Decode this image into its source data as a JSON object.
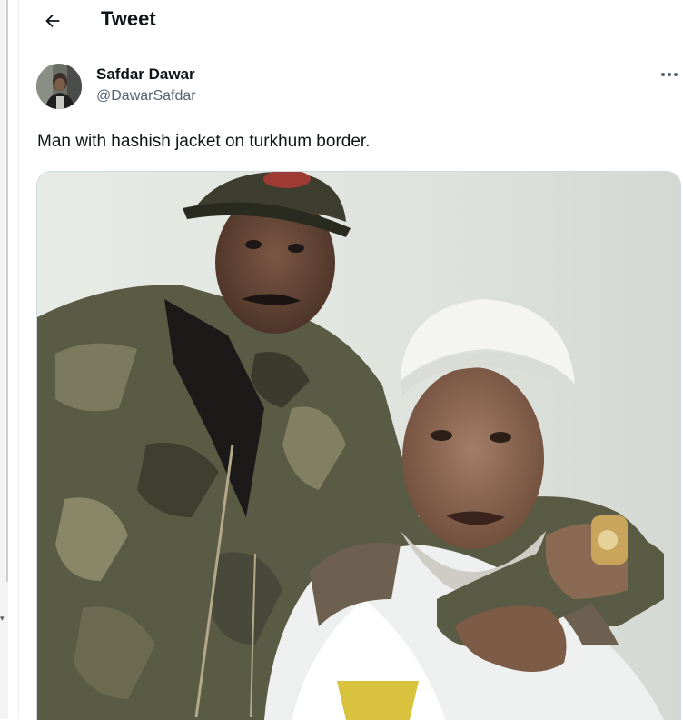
{
  "header": {
    "title": "Tweet",
    "back_icon": "arrow-left-icon"
  },
  "author": {
    "display_name": "Safdar Dawar",
    "handle": "@DawarSafdar",
    "avatar": "avatar-photo"
  },
  "tweet": {
    "text": "Man with hashish jacket on turkhum border.",
    "more_icon": "more-horizontal-icon",
    "media": "photo-two-men-uniform-and-white-cap"
  },
  "colors": {
    "text_primary": "#0f1419",
    "text_secondary": "#536471",
    "border": "#cfd9de"
  }
}
